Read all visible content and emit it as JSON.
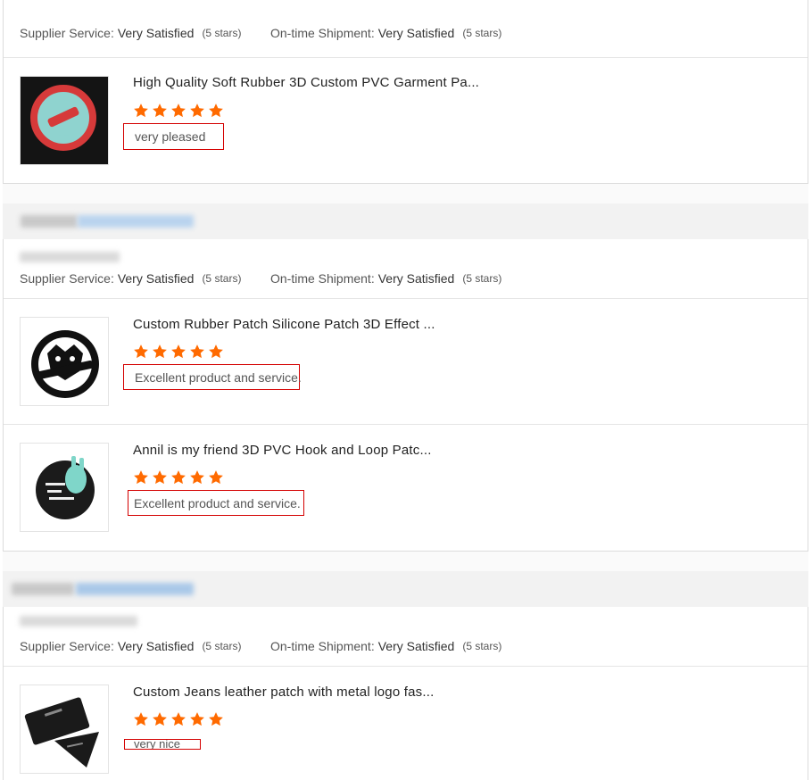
{
  "sections": [
    {
      "supplier_label": "Supplier Service:",
      "supplier_value": "Very Satisfied",
      "supplier_stars": "(5 stars)",
      "shipment_label": "On-time Shipment:",
      "shipment_value": "Very Satisfied",
      "shipment_stars": "(5 stars)",
      "products": [
        {
          "title": "High Quality Soft Rubber 3D Custom PVC Garment Pa...",
          "rating": 5,
          "feedback": "very pleased",
          "thumb_icon": "patch-logo-icon"
        }
      ]
    },
    {
      "supplier_label": "Supplier Service:",
      "supplier_value": "Very Satisfied",
      "supplier_stars": "(5 stars)",
      "shipment_label": "On-time Shipment:",
      "shipment_value": "Very Satisfied",
      "shipment_stars": "(5 stars)",
      "products": [
        {
          "title": "Custom Rubber Patch Silicone Patch 3D Effect ...",
          "rating": 5,
          "feedback": "Excellent product and service.",
          "thumb_icon": "tiger-patch-icon"
        },
        {
          "title": "Annil is my friend 3D PVC Hook and Loop Patc...",
          "rating": 5,
          "feedback": "Excellent product and service.",
          "thumb_icon": "bunny-patch-icon"
        }
      ]
    },
    {
      "supplier_label": "Supplier Service:",
      "supplier_value": "Very Satisfied",
      "supplier_stars": "(5 stars)",
      "shipment_label": "On-time Shipment:",
      "shipment_value": "Very Satisfied",
      "shipment_stars": "(5 stars)",
      "products": [
        {
          "title": "Custom Jeans leather patch with metal logo fas...",
          "rating": 5,
          "feedback": "very nice",
          "thumb_icon": "leather-patch-icon"
        }
      ]
    }
  ],
  "colors": {
    "star": "#ff6a00",
    "feedback_border": "#d40000",
    "blur_gray": "#c8c8c8",
    "blur_blue": "#a9c8e8"
  }
}
